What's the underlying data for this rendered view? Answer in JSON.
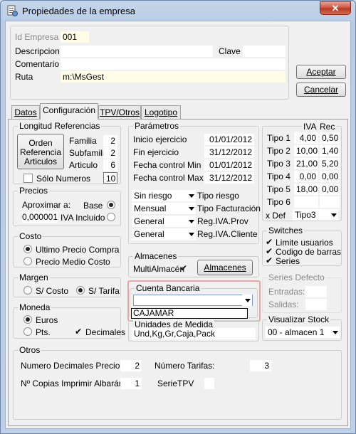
{
  "window": {
    "title": "Propiedades de la empresa",
    "close_label": "✕"
  },
  "top": {
    "id_label": "Id Empresa",
    "id_value": "001",
    "descripcion_label": "Descripcion",
    "descripcion_value": "",
    "clave_label": "Clave",
    "clave_value": "",
    "comentario_label": "Comentario",
    "comentario_value": "",
    "ruta_label": "Ruta",
    "ruta_value": "m:\\MsGest",
    "aceptar": "Aceptar",
    "cancelar": "Cancelar"
  },
  "tabs": [
    "Datos",
    "Configuración",
    "TPV/Otros",
    "Logotipo"
  ],
  "longitud": {
    "title": "Longitud Referencias",
    "button": "Orden Referencia Articulos",
    "familia_label": "Familia",
    "familia_value": "2",
    "subfamilia_label": "Subfamilia",
    "subfamilia_value": "2",
    "articulo_label": "Articulo",
    "articulo_value": "6",
    "solo_numeros": "Sólo Numeros",
    "solo_value": "10"
  },
  "precios": {
    "title": "Precios",
    "aproximar_label": "Aproximar a:",
    "aproximar_value": "0,000001",
    "base": "Base",
    "iva_incluido": "IVA Incluido"
  },
  "costo": {
    "title": "Costo",
    "ultimo": "Ultimo Precio Compra",
    "medio": "Precio Medio Costo"
  },
  "margen": {
    "title": "Margen",
    "s_costo": "S/ Costo",
    "s_tarifa": "S/ Tarifa"
  },
  "moneda": {
    "title": "Moneda",
    "euros": "Euros",
    "pts": "Pts.",
    "decimales": "Decimales"
  },
  "parametros": {
    "title": "Parámetros",
    "inicio_label": "Inicio ejercicio",
    "inicio_value": "01/01/2012",
    "fin_label": "Fin ejercicio",
    "fin_value": "31/12/2012",
    "fcmin_label": "Fecha control Min",
    "fcmin_value": "01/01/2012",
    "fcmax_label": "Fecha control Max",
    "fcmax_value": "31/12/2012",
    "riesgo_value": "Sin riesgo",
    "riesgo_label": "Tipo riesgo",
    "fact_value": "Mensual",
    "fact_label": "Tipo Facturación",
    "ivaprov_value": "General",
    "ivaprov_label": "Reg.IVA.Prov",
    "ivacli_value": "General",
    "ivacli_label": "Reg.IVA.Cliente"
  },
  "iva": {
    "header_iva": "IVA",
    "header_rec": "Rec",
    "rows": [
      {
        "label": "Tipo 1",
        "iva": "4,00",
        "rec": "0,50"
      },
      {
        "label": "Tipo 2",
        "iva": "10,00",
        "rec": "1,40"
      },
      {
        "label": "Tipo 3",
        "iva": "21,00",
        "rec": "5,20"
      },
      {
        "label": "Tipo 4",
        "iva": "0,00",
        "rec": "0,00"
      },
      {
        "label": "Tipo 5",
        "iva": "18,00",
        "rec": "0,00"
      },
      {
        "label": "Tipo 6",
        "iva": "",
        "rec": ""
      }
    ],
    "xdef_label": "x Def",
    "xdef_value": "Tipo3"
  },
  "switches": {
    "title": "Switches",
    "items": [
      "Limite usuarios",
      "Codigo de barras",
      "Series"
    ]
  },
  "almacenes": {
    "title": "Almacenes",
    "multi": "MultiAlmacén",
    "button": "Almacenes"
  },
  "series": {
    "title": "Series Defecto",
    "entradas": "Entradas:",
    "salidas": "Salidas:"
  },
  "cuenta": {
    "title": "Cuenta Bancaria",
    "value": "",
    "option": "CAJAMAR",
    "highlight_color": "#e8a0a0"
  },
  "unidades": {
    "title": "Unidades de Medida",
    "value": "Und,Kg,Gr,Caja,Pack"
  },
  "stock": {
    "title": "Visualizar Stock",
    "value": "00 - almacen 1"
  },
  "otros": {
    "title": "Otros",
    "decimales_label": "Numero Decimales Precio:",
    "decimales_value": "2",
    "tarifas_label": "Número Tarifas:",
    "tarifas_value": "3",
    "copias_label": "Nº Copias Imprimir Albarán",
    "copias_value": "1",
    "serie_label": "SerieTPV",
    "serie_value": ""
  }
}
